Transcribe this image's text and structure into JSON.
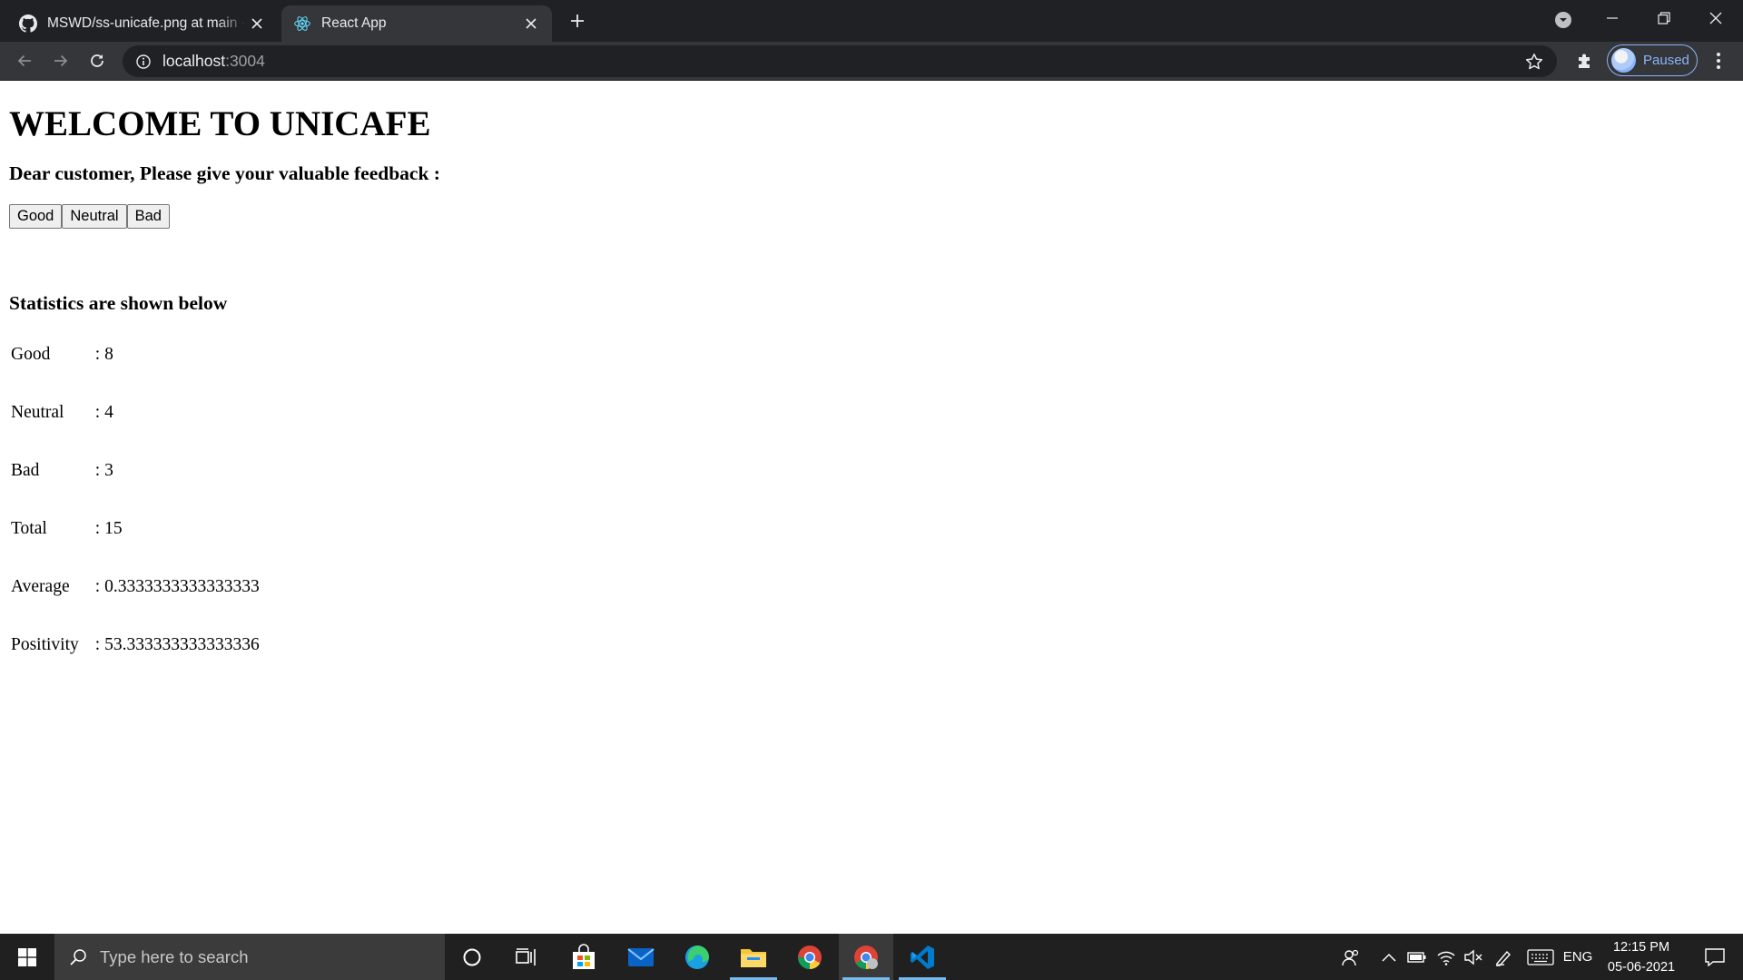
{
  "browser": {
    "tabs": [
      {
        "title": "MSWD/ss-unicafe.png at main · MSWD",
        "favicon": "github-icon",
        "active": false
      },
      {
        "title": "React App",
        "favicon": "react-icon",
        "active": true
      }
    ],
    "url_host": "localhost",
    "url_port": ":3004",
    "profile_label": "Paused"
  },
  "page": {
    "title": "WELCOME TO UNICAFE",
    "prompt": "Dear customer, Please give your valuable feedback :",
    "buttons": {
      "good": "Good",
      "neutral": "Neutral",
      "bad": "Bad"
    },
    "stats_title": "Statistics are shown below",
    "stats": [
      {
        "label": "Good",
        "value": ": 8"
      },
      {
        "label": "Neutral",
        "value": ": 4"
      },
      {
        "label": "Bad",
        "value": ": 3"
      },
      {
        "label": "Total",
        "value": ": 15"
      },
      {
        "label": "Average",
        "value": ": 0.3333333333333333"
      },
      {
        "label": "Positivity",
        "value": ": 53.333333333333336"
      }
    ]
  },
  "taskbar": {
    "search_placeholder": "Type here to search",
    "language": "ENG",
    "time": "12:15 PM",
    "date": "05-06-2021"
  },
  "colors": {
    "tab_bar": "#202124",
    "toolbar": "#35363a",
    "accent": "#8ab4f8",
    "taskbar": "#202020"
  }
}
